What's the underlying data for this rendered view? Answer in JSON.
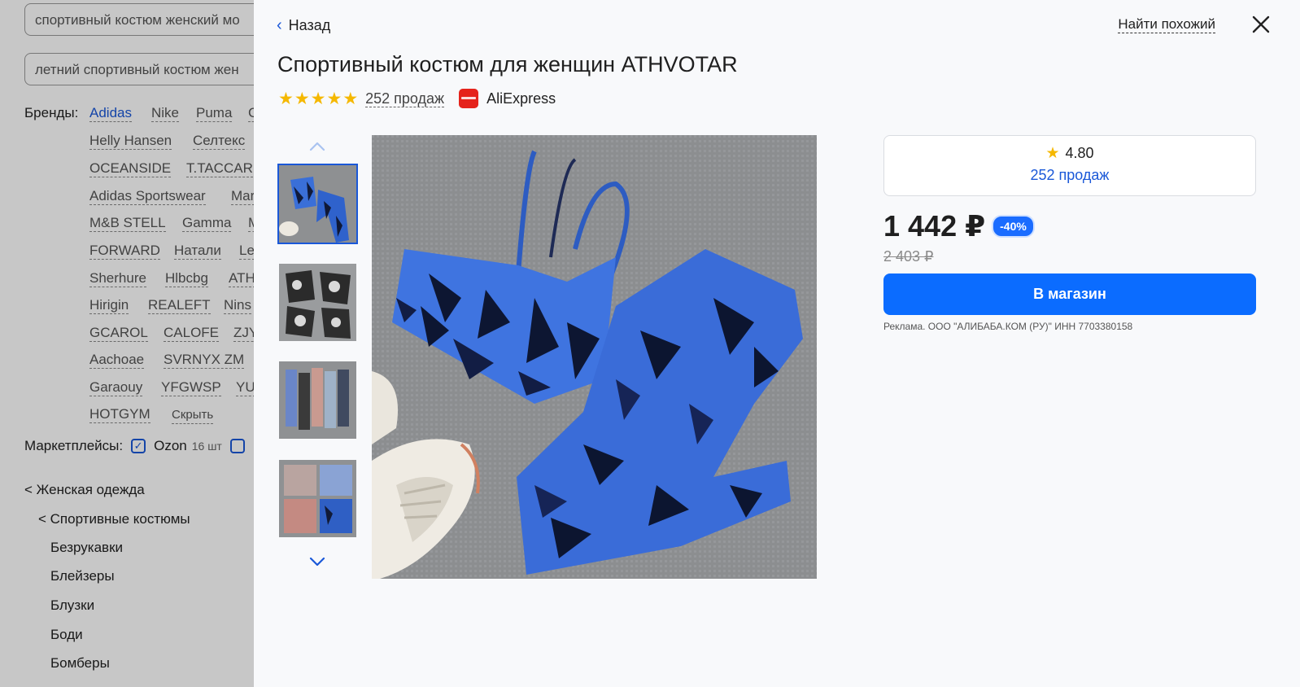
{
  "background": {
    "search_queries": [
      "спортивный костюм женский мо",
      "летний спортивный костюм жен"
    ],
    "brands_label": "Бренды:",
    "brands": [
      [
        "Adidas",
        "Nike",
        "Puma",
        "C"
      ],
      [
        "Helly Hansen",
        "Селтекс"
      ],
      [
        "OCEANSIDE",
        "T.TACCAR"
      ],
      [
        "Adidas Sportswear",
        "Mar"
      ],
      [
        "M&B STELL",
        "Gamma",
        "M"
      ],
      [
        "FORWARD",
        "Натали",
        "Le"
      ],
      [
        "Sherhure",
        "Hlbcbg",
        "ATH"
      ],
      [
        "Hirigin",
        "REALEFT",
        "Nins"
      ],
      [
        "GCAROL",
        "CALOFE",
        "ZJY"
      ],
      [
        "Aachoae",
        "SVRNYX ZM"
      ],
      [
        "Garaouy",
        "YFGWSP",
        "YU"
      ],
      [
        "HOTGYM",
        "Скрыть"
      ]
    ],
    "marketplaces_label": "Маркетплейсы:",
    "marketplace": "Ozon",
    "marketplace_count": "16 шт",
    "categories": [
      "< Женская одежда",
      "< Спортивные костюмы",
      "Безрукавки",
      "Блейзеры",
      "Блузки",
      "Боди",
      "Бомберы"
    ]
  },
  "panel": {
    "back_label": "Назад",
    "find_similar_label": "Найти похожий",
    "title": "Спортивный костюм для женщин ATHVOTAR",
    "stars_count": 5,
    "sales_label": "252 продаж",
    "store_name": "AliExpress",
    "rating_value": "4.80",
    "rating_sales": "252 продаж",
    "price": "1 442 ₽",
    "discount": "-40%",
    "old_price": "2 403 ₽",
    "shop_button_label": "В магазин",
    "ad_note": "Реклама. ООО \"АЛИБАБА.КОМ (РУ)\" ИНН 7703380158",
    "store_logo_text": "AliExpress"
  },
  "colors": {
    "accent": "#1a58d8",
    "button": "#0b6cff",
    "star": "#f5b800",
    "store_logo": "#e5231b"
  },
  "icons": [
    "chevron-left-icon",
    "close-icon",
    "star-icon",
    "chevron-up-icon",
    "chevron-down-icon",
    "aliexpress-logo",
    "checkbox-checked-icon"
  ]
}
